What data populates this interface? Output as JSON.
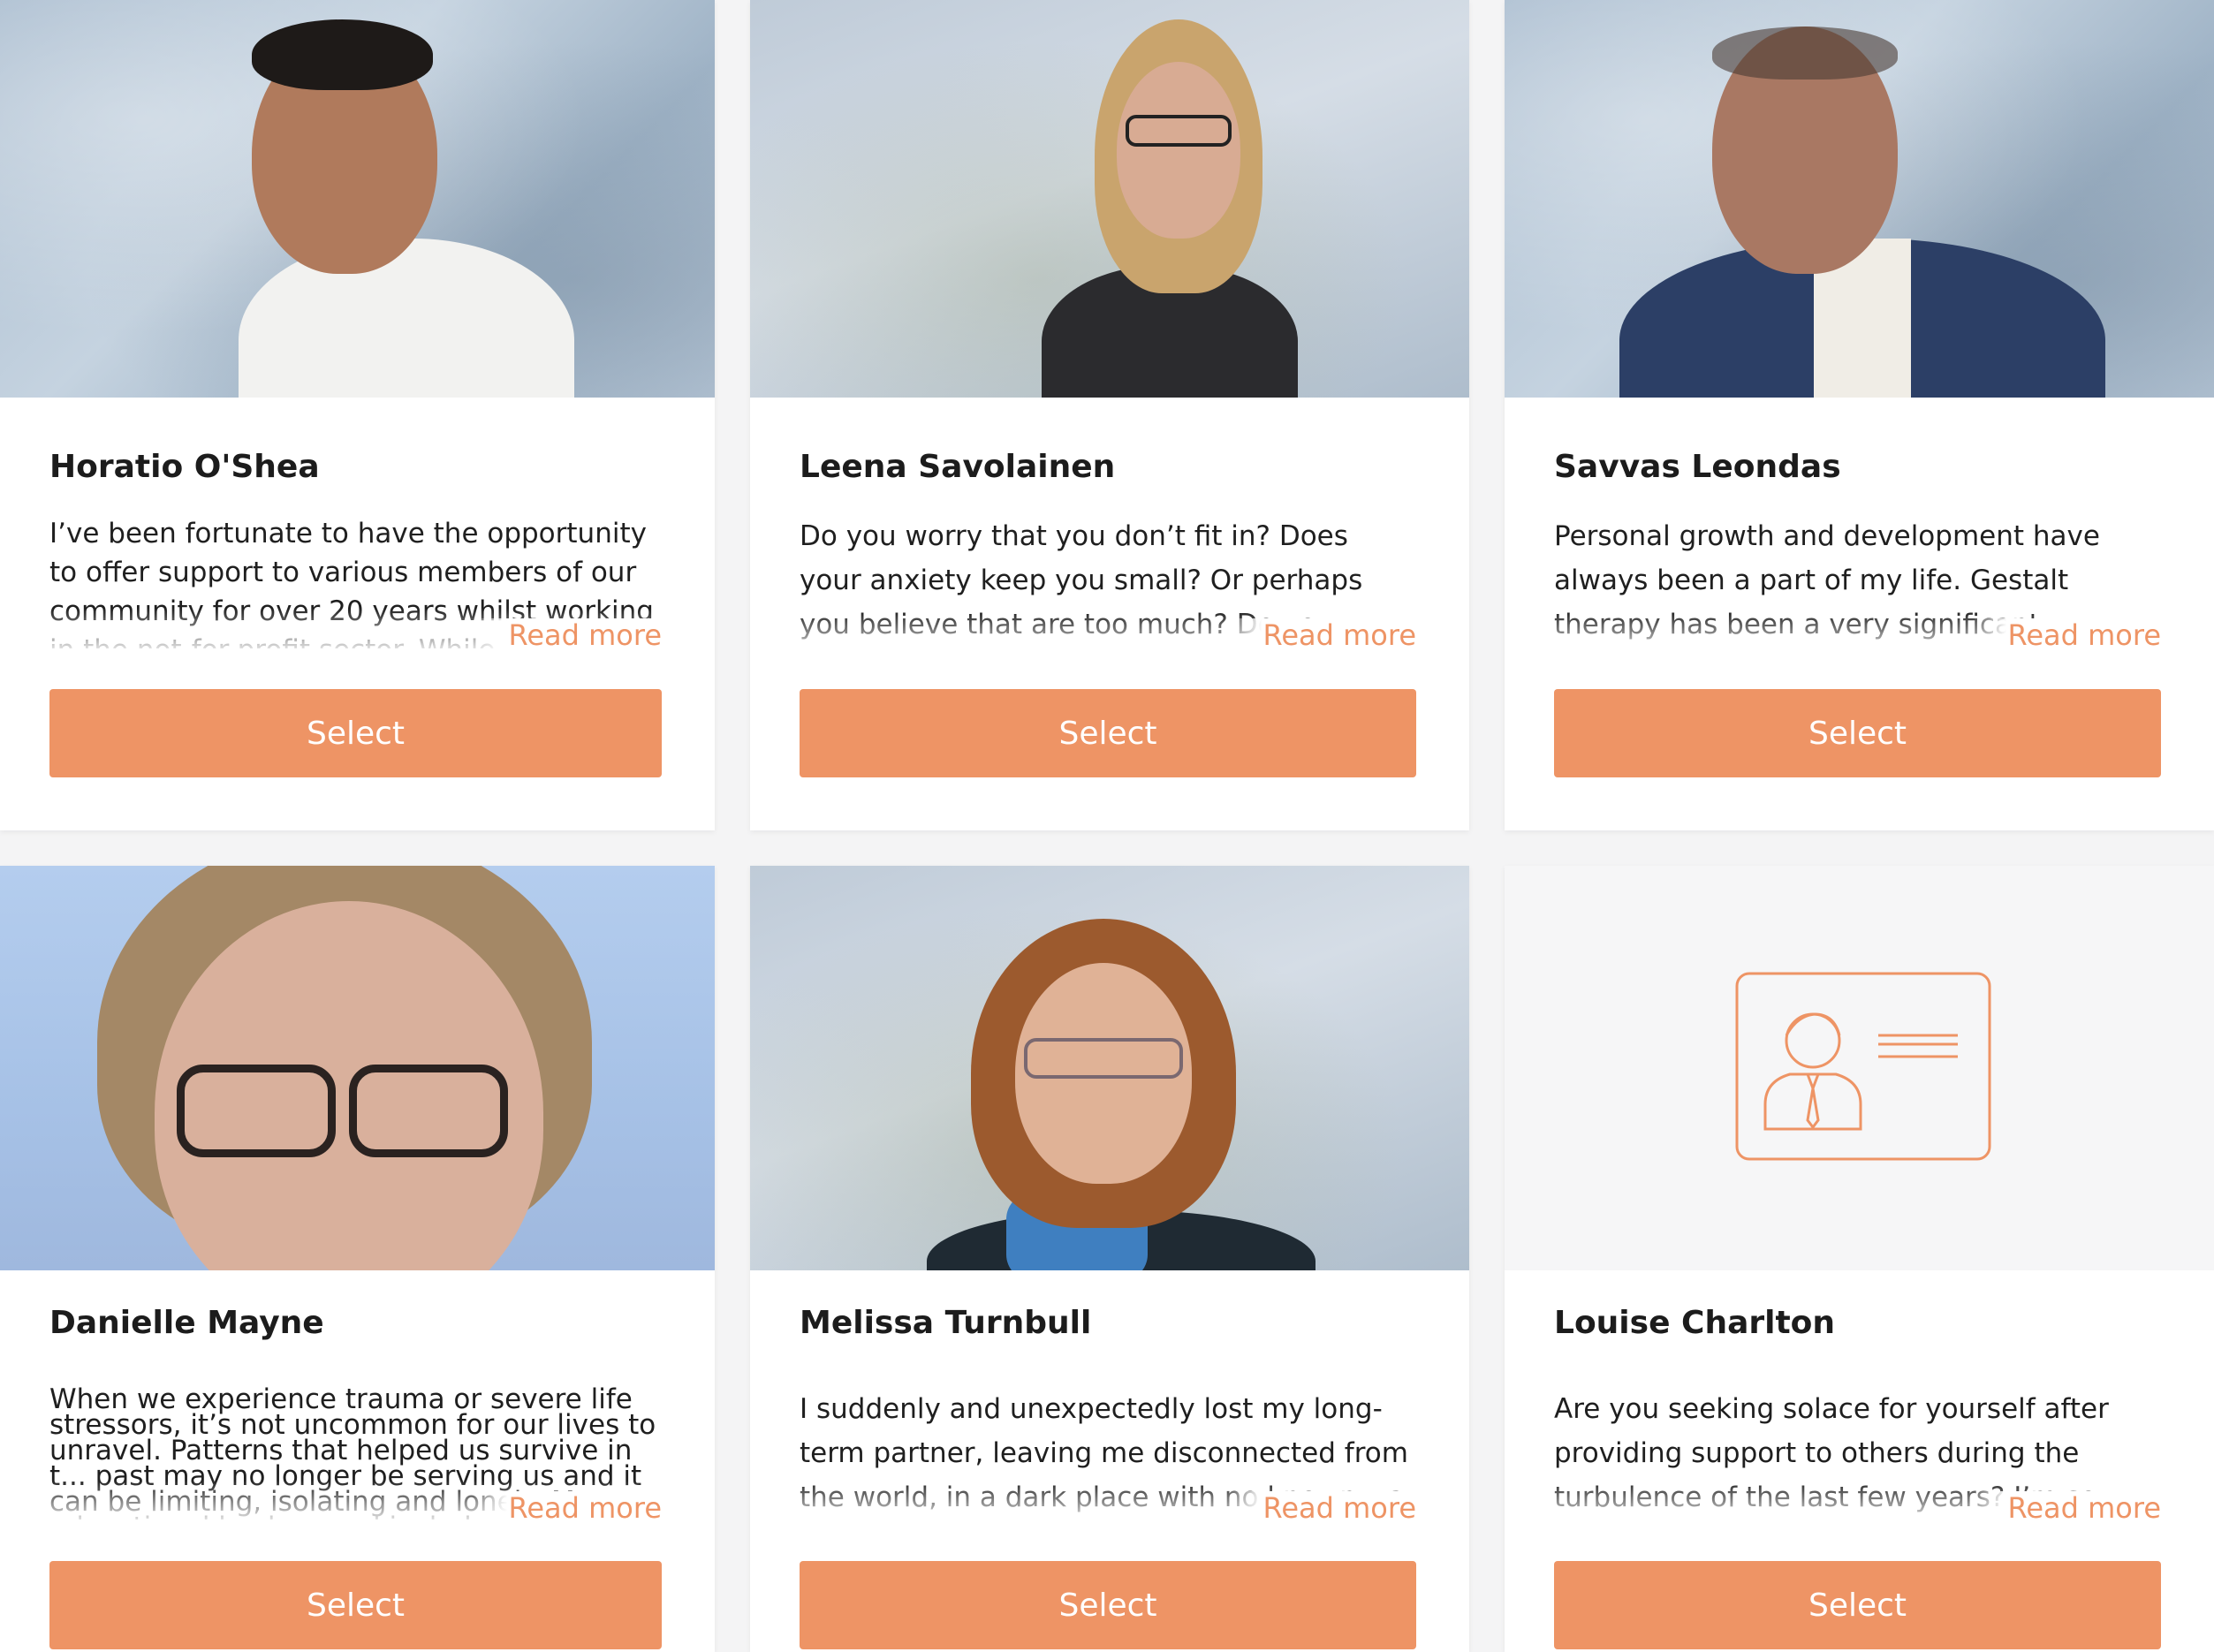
{
  "colors": {
    "accent": "#ee9465",
    "background": "#f4f4f5",
    "card": "#ffffff",
    "text": "#1c1c1c"
  },
  "read_more_label": "Read more",
  "select_label": "Select",
  "counsellors": [
    {
      "name": "Horatio O'Shea",
      "bio": "I’ve been fortunate to have the opportunity to offer support to various members of our community for over 20 years whilst working in the not-for-profit sector. While",
      "photo_icon": "portrait-photo"
    },
    {
      "name": "Leena Savolainen",
      "bio": "Do you worry that you don’t fit in? Does your anxiety keep you small? Or perhaps you believe that are too much? Do you struggle",
      "photo_icon": "portrait-photo"
    },
    {
      "name": "Savvas Leondas",
      "bio": "Personal growth and development have always been a part of my life. Gestalt therapy has been a very significant contributing fact",
      "photo_icon": "portrait-photo"
    },
    {
      "name": "Danielle Mayne",
      "bio": "When we experience trauma or severe life stressors, it’s not uncommon for our lives to unravel. Patterns that helped us survive in t... past may no longer be serving us and it can be limiting, isolating and lonely. My educational background includes a Bachelor of Criminology, Advanced C&Adv",
      "photo_icon": "portrait-photo"
    },
    {
      "name": "Melissa Turnbull",
      "bio": "I suddenly and unexpectedly lost my long-term partner, leaving me disconnected from the world, in a dark place with no known wa",
      "photo_icon": "portrait-photo"
    },
    {
      "name": "Louise Charlton",
      "bio": "Are you seeking solace for yourself after providing support to others during the turbulence of the last few years? I’m so",
      "photo_icon": "id-card-placeholder-icon"
    }
  ]
}
